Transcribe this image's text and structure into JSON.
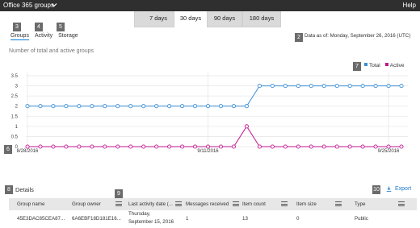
{
  "header": {
    "app_title": "Office 365 groups",
    "help": "Help"
  },
  "period_tabs": [
    {
      "label": "7 days",
      "badge": "1"
    },
    {
      "label": "30 days"
    },
    {
      "label": "90 days"
    },
    {
      "label": "180 days"
    }
  ],
  "selected_tab": "30 days",
  "report_tabs": [
    {
      "label": "Groups",
      "badge": "3"
    },
    {
      "label": "Activity",
      "badge": "4"
    },
    {
      "label": "Storage",
      "badge": "5"
    }
  ],
  "data_as_of": {
    "badge": "2",
    "text": "Data as of: Monday, September 26, 2016 (UTC)"
  },
  "chart_title": "Number of total and active groups",
  "legend": {
    "badge": "7"
  },
  "chart_badge": "6",
  "chart_data": {
    "type": "line",
    "x": [
      "8/28/2016",
      "8/29/2016",
      "8/30/2016",
      "8/31/2016",
      "9/1/2016",
      "9/2/2016",
      "9/3/2016",
      "9/4/2016",
      "9/5/2016",
      "9/6/2016",
      "9/7/2016",
      "9/8/2016",
      "9/9/2016",
      "9/10/2016",
      "9/11/2016",
      "9/12/2016",
      "9/13/2016",
      "9/14/2016",
      "9/15/2016",
      "9/16/2016",
      "9/17/2016",
      "9/18/2016",
      "9/19/2016",
      "9/20/2016",
      "9/21/2016",
      "9/22/2016",
      "9/23/2016",
      "9/24/2016",
      "9/25/2016",
      "9/26/2016"
    ],
    "x_tick_labels": [
      "8/28/2016",
      "9/11/2016",
      "9/25/2016"
    ],
    "series": [
      {
        "name": "Total",
        "color": "#3b8ed6",
        "values": [
          2,
          2,
          2,
          2,
          2,
          2,
          2,
          2,
          2,
          2,
          2,
          2,
          2,
          2,
          2,
          2,
          2,
          2,
          3,
          3,
          3,
          3,
          3,
          3,
          3,
          3,
          3,
          3,
          3,
          3
        ]
      },
      {
        "name": "Active",
        "color": "#c2168f",
        "values": [
          0,
          0,
          0,
          0,
          0,
          0,
          0,
          0,
          0,
          0,
          0,
          0,
          0,
          0,
          0,
          0,
          0,
          1,
          0,
          0,
          0,
          0,
          0,
          0,
          0,
          0,
          0,
          0,
          0,
          0
        ]
      }
    ],
    "yticks": [
      "0",
      "0.5",
      "1",
      "1.5",
      "2",
      "2.5",
      "3",
      "3.5"
    ],
    "ylim": [
      0,
      3.5
    ],
    "grid": true,
    "legend_position": "top-right"
  },
  "details": {
    "badge": "8",
    "label": "Details"
  },
  "export": {
    "badge": "10",
    "label": "Export"
  },
  "table": {
    "menu_badge": "9",
    "columns": [
      "Group name",
      "Group owner",
      "Last activity date (...",
      "Messages received",
      "Item count",
      "Item size",
      "Type"
    ],
    "rows": [
      {
        "group_name": "45E3DAC85CEA87...",
        "group_owner": "6A6EBF18D181E16...",
        "last_activity_line1": "Thursday,",
        "last_activity_line2": "September 15, 2016",
        "messages_received": "1",
        "item_count": "13",
        "item_size": "0",
        "type": "Public"
      }
    ]
  }
}
